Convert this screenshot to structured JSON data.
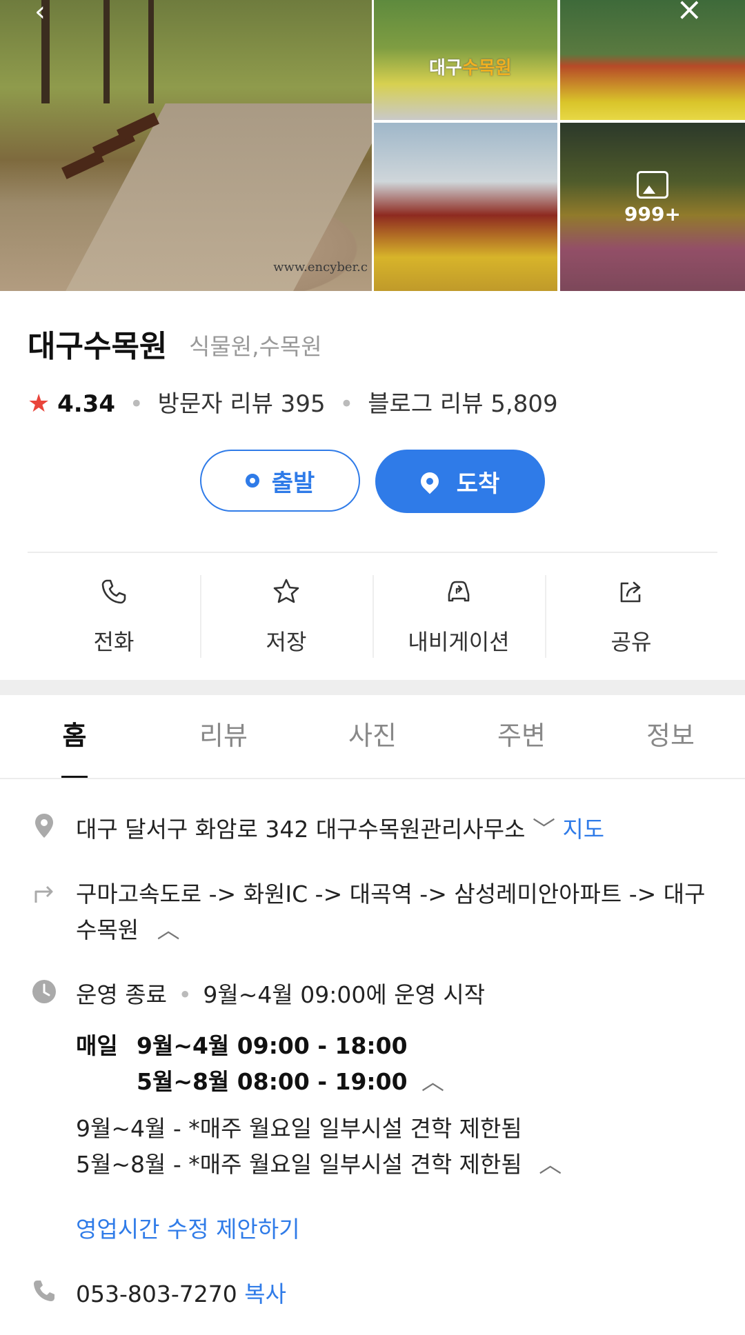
{
  "photos": {
    "more_count": "999+",
    "watermark": "www.encyber.c",
    "sign_text": "대구",
    "sign_highlight": "수목원"
  },
  "place": {
    "name": "대구수목원",
    "category": "식물원,수목원",
    "rating": "4.34",
    "visitor_review": "방문자 리뷰 395",
    "blog_review": "블로그 리뷰 5,809"
  },
  "route": {
    "depart_label": "출발",
    "arrive_label": "도착"
  },
  "actions": [
    {
      "label": "전화",
      "icon": "phone-icon"
    },
    {
      "label": "저장",
      "icon": "star-icon"
    },
    {
      "label": "내비게이션",
      "icon": "car-navigation-icon"
    },
    {
      "label": "공유",
      "icon": "share-icon"
    }
  ],
  "tabs": [
    "홈",
    "리뷰",
    "사진",
    "주변",
    "정보"
  ],
  "active_tab": "홈",
  "info": {
    "address": "대구 달서구 화암로 342 대구수목원관리사무소",
    "map_link": "지도",
    "directions_line1": "구마고속도로 -> 화원IC -> 대곡역 -> 삼성레미안아파트 -> 대구",
    "directions_line2": "수목원",
    "status": "운영 종료",
    "status_next": "9월~4월 09:00에 운영 시작",
    "hours_day": "매일",
    "hours_line1": "9월~4월 09:00 - 18:00",
    "hours_line2": "5월~8월 08:00 - 19:00",
    "note1": "9월~4월 - *매주 월요일 일부시설 견학 제한됨",
    "note2": "5월~8월 - *매주 월요일 일부시설 견학 제한됨",
    "suggest_hours": "영업시간 수정 제안하기",
    "phone": "053-803-7270",
    "copy_label": "복사"
  },
  "colors": {
    "accent": "#2f7be8",
    "star": "#e9453b",
    "icon_gray": "#aaaaaa"
  }
}
